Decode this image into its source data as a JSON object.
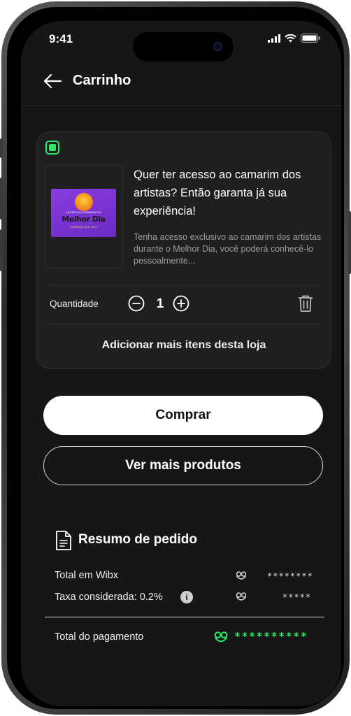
{
  "status_bar": {
    "time": "9:41"
  },
  "header": {
    "title": "Carrinho"
  },
  "cart_item": {
    "selected": true,
    "product_image": {
      "brand": "Melhor Dia",
      "top_text": "ACESSO AO CAMARIM DO",
      "bottom_text": "GARANTA JÁ O SEU"
    },
    "title": "Quer ter acesso ao camarim dos artistas? Então garanta já sua experiência!",
    "description": "Tenha acesso exclusivo ao camarim dos artistas durante o Melhor Dia, você poderá conhecê-lo pessoalmente...",
    "quantity_label": "Quantidade",
    "quantity": "1",
    "add_more_label": "Adicionar mais itens desta loja"
  },
  "actions": {
    "buy_label": "Comprar",
    "more_products_label": "Ver mais produtos"
  },
  "summary": {
    "title": "Resumo de pedido",
    "total_wibx_label": "Total em Wibx",
    "total_wibx_value": "********",
    "fee_label": "Taxa considerada: 0.2%",
    "fee_value": "*****",
    "total_payment_label": "Total do pagamento",
    "total_payment_value": "**********"
  },
  "colors": {
    "accent": "#2ee86a",
    "background": "#161616",
    "card": "#1f1f1f"
  }
}
